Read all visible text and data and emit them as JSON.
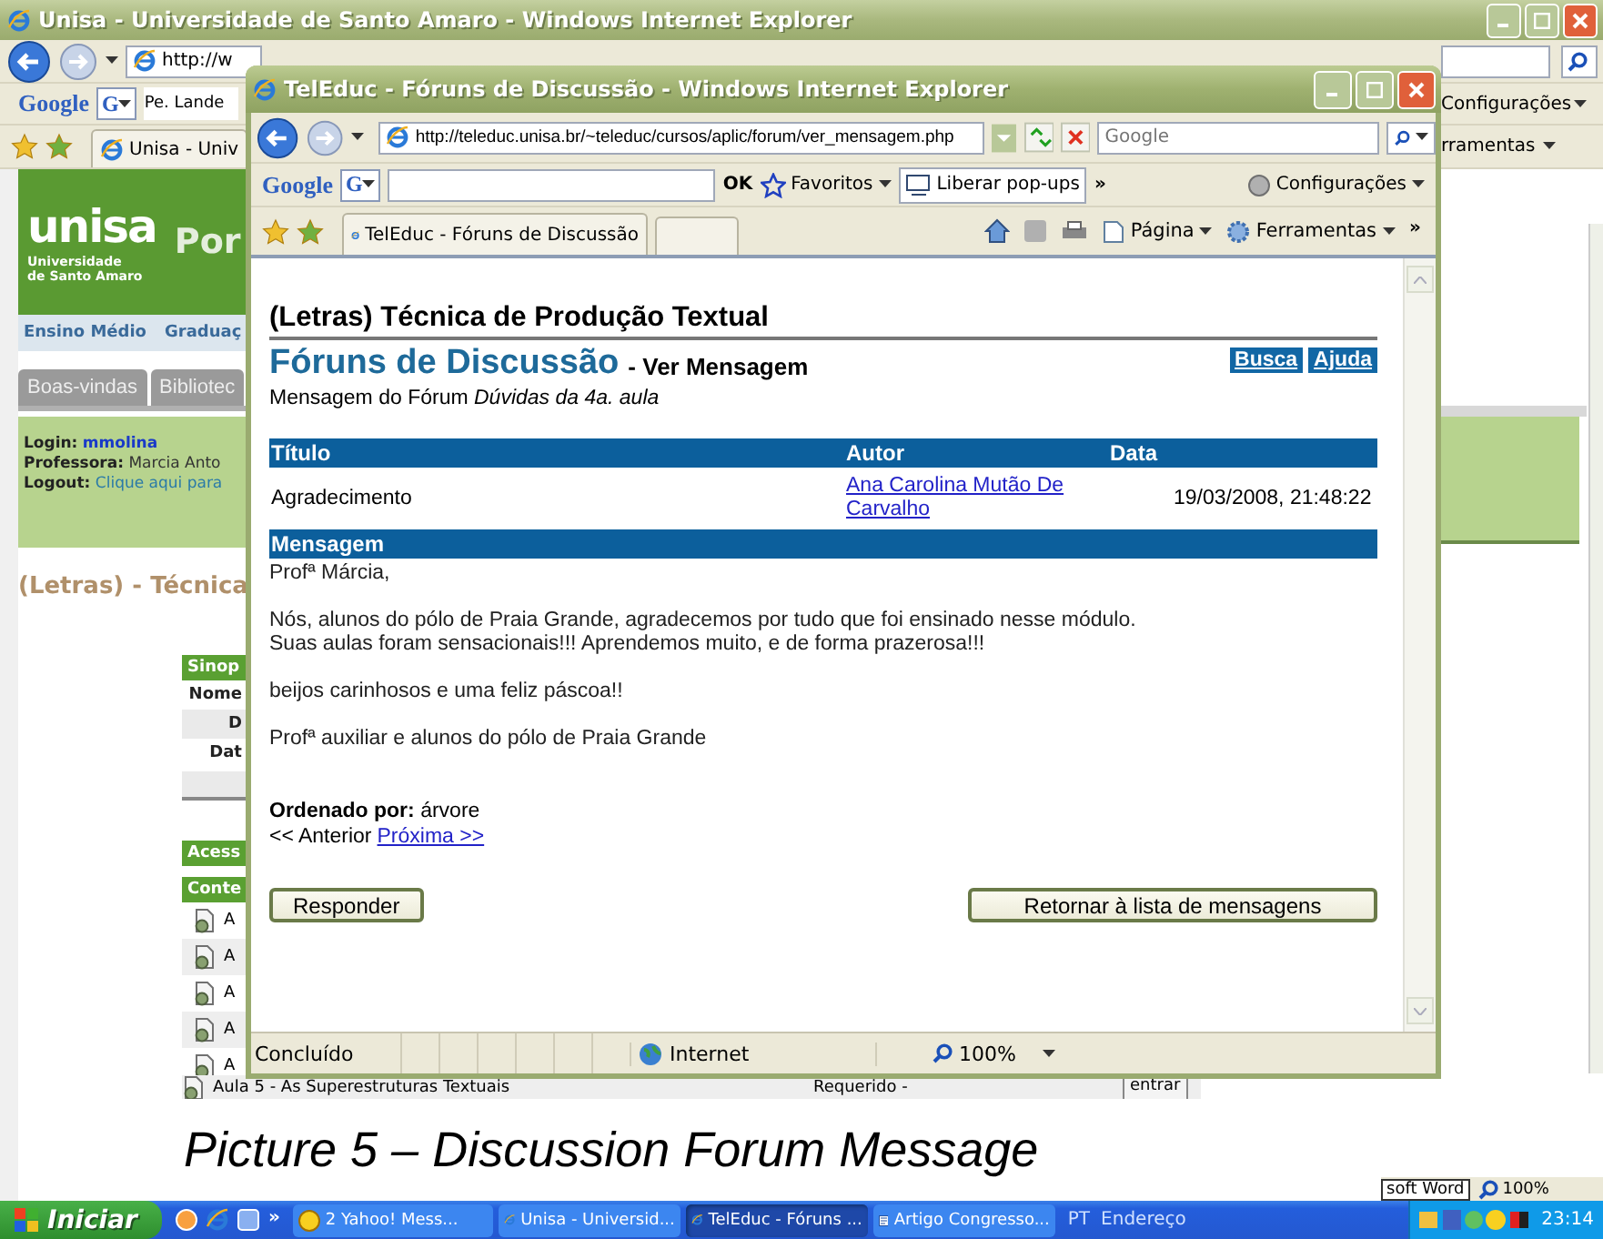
{
  "back_window": {
    "title": "Unisa - Universidade de Santo Amaro - Windows Internet Explorer",
    "address": "http://w",
    "search_logo": "Google",
    "search_engine": "G",
    "search_text": "Pe. Lande",
    "tab": "Unisa - Univ",
    "toolbar_items": [
      "Configurações",
      "rramentas"
    ],
    "logo": {
      "name": "unisa",
      "subtitle": [
        "Universidade",
        "de Santo Amaro"
      ]
    },
    "heading": "Por",
    "nav": [
      "Ensino Médio",
      "Graduaç"
    ],
    "tabs": [
      "Boas-vindas",
      "Bibliotec"
    ],
    "session": [
      {
        "label": "Login:",
        "value": "mmolina",
        "kind": "user"
      },
      {
        "label": "Professora:",
        "value": "Marcia Anto",
        "kind": "text"
      },
      {
        "label": "Logout:",
        "value": "Clique aqui para",
        "kind": "link"
      }
    ],
    "course_title": "(Letras) - Técnica",
    "synopsis": {
      "header": "Sinop",
      "rows": [
        "Nome",
        "D",
        "Dat"
      ]
    },
    "access_header": "Acess",
    "content_header": "Conte",
    "content_items": [
      "A",
      "A",
      "A",
      "A",
      "A"
    ],
    "lesson": {
      "title": "Aula 5 - As Superestruturas Textuais",
      "requirement": "Requerido -",
      "button": "entrar"
    }
  },
  "front_window": {
    "title": "TelEduc - Fóruns de Discussão - Windows Internet Explorer",
    "address": "http://teleduc.unisa.br/~teleduc/cursos/aplic/forum/ver_mensagem.php",
    "search": {
      "placeholder": "Google"
    },
    "search_logo": "Google",
    "search_engine": "G",
    "toolbar": [
      {
        "label": "OK",
        "kind": "text"
      },
      {
        "label": "Favoritos",
        "kind": "menu"
      },
      {
        "label": "Liberar pop-ups",
        "kind": "button"
      },
      {
        "label": "»",
        "kind": "text"
      }
    ],
    "settings": "Configurações",
    "tab": "TelEduc - Fóruns de Discussão",
    "commands": [
      "Página",
      "Ferramentas"
    ],
    "more": "»",
    "page": {
      "course": "(Letras) Técnica de Produção Textual",
      "tool": "Fóruns de Discussão",
      "view": "- Ver Mensagem",
      "links": [
        "Busca",
        "Ajuda"
      ],
      "forum_line": "Mensagem do Fórum *Dúvidas da 4a. aula*",
      "columns": [
        "Título",
        "Autor",
        "Data"
      ],
      "row": {
        "title": "Agradecimento",
        "author": "Ana Carolina Mutão De Carvalho",
        "date": "19/03/2008, 21:48:22"
      },
      "message_header": "Mensagem",
      "message": [
        {
          "lines": [
            "Profª Márcia,"
          ]
        },
        {
          "lines": [
            "Nós, alunos do pólo de Praia Grande, agradecemos por tudo que foi ensinado nesse módulo.",
            "Suas aulas foram sensacionais!!! Aprendemos muito, e de forma prazerosa!!!"
          ]
        },
        {
          "lines": [
            "beijos carinhosos e uma feliz páscoa!!"
          ]
        },
        {
          "lines": [
            "Profª auxiliar e alunos do pólo de Praia Grande"
          ]
        }
      ],
      "order": "**Ordenado por:** árvore",
      "previous": "<< Anterior",
      "next": "Próxima >>",
      "buttons": [
        "Responder",
        "Retornar à lista de mensagens"
      ]
    },
    "status": {
      "text": "Concluído",
      "zone": "Internet",
      "zoom": "100%"
    }
  },
  "caption": "Picture 5 – Discussion Forum Message",
  "word_status": {
    "app": "soft Word",
    "zoom": "100%"
  },
  "taskbar": {
    "start": "Iniciar",
    "more": "»",
    "items": [
      {
        "label": "2 Yahoo! Mess...",
        "kind": "messenger",
        "selected": false
      },
      {
        "label": "Unisa - Universid...",
        "kind": "browser",
        "selected": false
      },
      {
        "label": "TelEduc - Fóruns ...",
        "kind": "browser",
        "selected": true
      },
      {
        "label": "Artigo Congresso...",
        "kind": "document",
        "selected": false
      }
    ],
    "language": "PT",
    "address": "Endereço",
    "time": "23:14"
  }
}
